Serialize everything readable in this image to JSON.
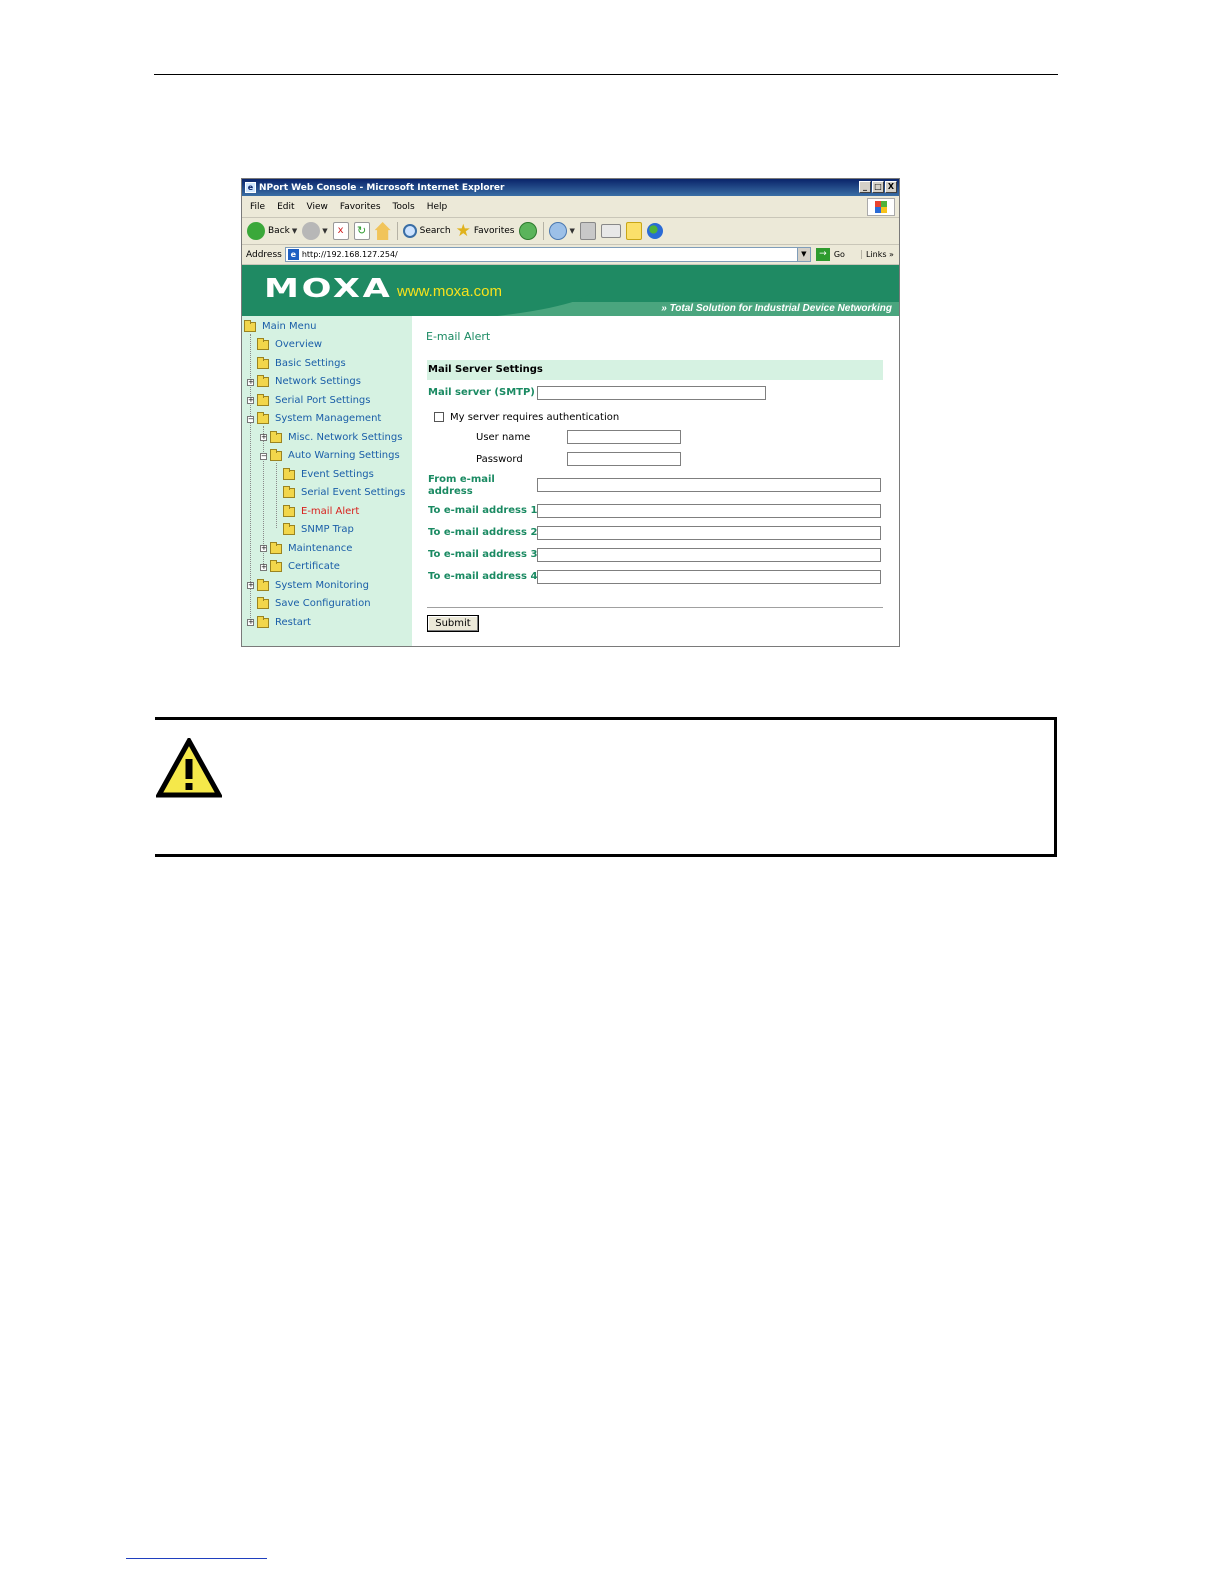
{
  "browser": {
    "title": "NPort Web Console - Microsoft Internet Explorer",
    "window_buttons": {
      "minimize": "_",
      "maximize": "□",
      "close": "X"
    },
    "menu": [
      "File",
      "Edit",
      "View",
      "Favorites",
      "Tools",
      "Help"
    ],
    "toolbar": {
      "back": "Back",
      "search": "Search",
      "favorites": "Favorites"
    },
    "address_label": "Address",
    "address": "http://192.168.127.254/",
    "go": "Go",
    "links": "Links"
  },
  "banner": {
    "logo": "MOXA",
    "url": "www.moxa.com",
    "tagline": "Total Solution for Industrial Device Networking"
  },
  "sidebar": {
    "items": [
      {
        "label": "Main Menu"
      },
      {
        "label": "Overview"
      },
      {
        "label": "Basic Settings"
      },
      {
        "label": "Network Settings"
      },
      {
        "label": "Serial Port Settings"
      },
      {
        "label": "System Management"
      },
      {
        "label": "Misc. Network Settings"
      },
      {
        "label": "Auto Warning Settings"
      },
      {
        "label": "Event Settings"
      },
      {
        "label": "Serial Event Settings"
      },
      {
        "label": "E-mail Alert"
      },
      {
        "label": "SNMP Trap"
      },
      {
        "label": "Maintenance"
      },
      {
        "label": "Certificate"
      },
      {
        "label": "System Monitoring"
      },
      {
        "label": "Save Configuration"
      },
      {
        "label": "Restart"
      }
    ]
  },
  "form": {
    "title": "E-mail Alert",
    "section": "Mail Server Settings",
    "mail_server_label": "Mail server (SMTP)",
    "mail_server_value": "",
    "auth_label": "My server requires authentication",
    "auth_checked": false,
    "username_label": "User name",
    "password_label": "Password",
    "from_label_line1": "From e-mail",
    "from_label_line2": "address",
    "to1_label": "To e-mail address 1",
    "to2_label": "To e-mail address 2",
    "to3_label": "To e-mail address 3",
    "to4_label": "To e-mail address 4",
    "submit": "Submit"
  },
  "colors": {
    "brand_green": "#1f8a63",
    "sidebar_bg": "#d6f2e2",
    "link_blue": "#1a5ea8",
    "active_red": "#d8211d",
    "warning_yellow": "#f5e84a"
  }
}
